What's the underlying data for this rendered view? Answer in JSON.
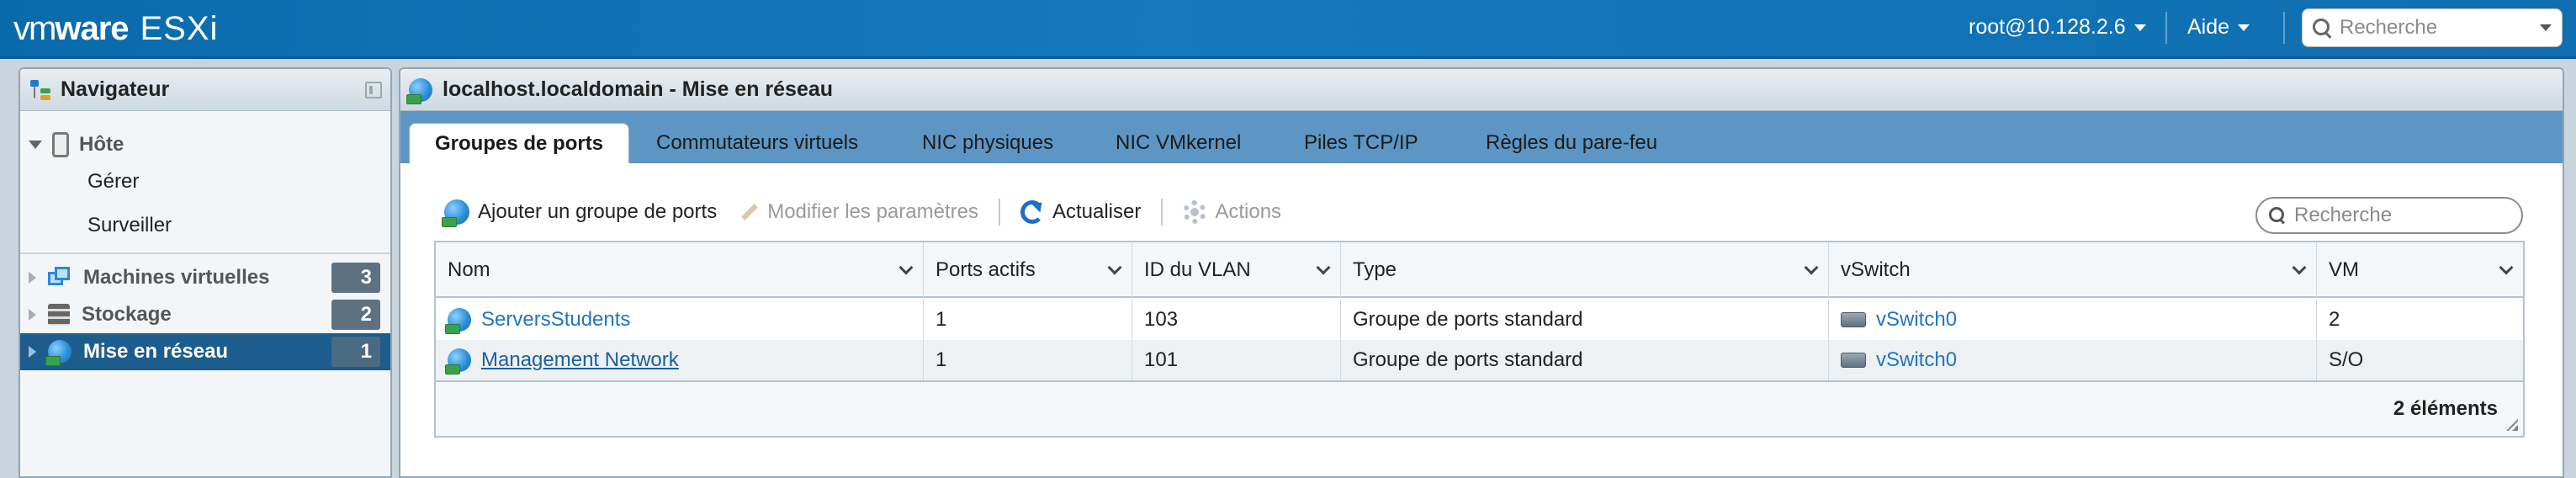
{
  "topbar": {
    "logo_vm": "vm",
    "logo_ware": "ware",
    "logo_product": "ESXi",
    "user": "root@10.128.2.6",
    "help": "Aide",
    "search_placeholder": "Recherche"
  },
  "navigator": {
    "title": "Navigateur",
    "host": {
      "label": "Hôte",
      "children": [
        "Gérer",
        "Surveiller"
      ]
    },
    "items": [
      {
        "label": "Machines virtuelles",
        "count": "3",
        "icon": "vm-icon"
      },
      {
        "label": "Stockage",
        "count": "2",
        "icon": "storage-icon"
      },
      {
        "label": "Mise en réseau",
        "count": "1",
        "icon": "network-icon",
        "selected": true
      }
    ]
  },
  "main": {
    "title": "localhost.localdomain - Mise en réseau",
    "tabs": [
      {
        "label": "Groupes de ports",
        "active": true
      },
      {
        "label": "Commutateurs virtuels"
      },
      {
        "label": "NIC physiques"
      },
      {
        "label": "NIC VMkernel"
      },
      {
        "label": "Piles TCP/IP"
      },
      {
        "label": "Règles du pare-feu"
      }
    ],
    "toolbar": {
      "add": "Ajouter un groupe de ports",
      "edit": "Modifier les paramètres",
      "refresh": "Actualiser",
      "actions": "Actions"
    },
    "search_placeholder": "Recherche",
    "table": {
      "columns": [
        "Nom",
        "Ports actifs",
        "ID du VLAN",
        "Type",
        "vSwitch",
        "VM"
      ],
      "rows": [
        {
          "name": "ServersStudents",
          "ports": "1",
          "vlan": "103",
          "type": "Groupe de ports standard",
          "vswitch": "vSwitch0",
          "vm": "2"
        },
        {
          "name": "Management Network",
          "ports": "1",
          "vlan": "101",
          "type": "Groupe de ports standard",
          "vswitch": "vSwitch0",
          "vm": "S/O"
        }
      ],
      "footer": "2 éléments"
    }
  },
  "colors": {
    "topbar": "#1479bd",
    "tabbar": "#5d96c4",
    "selected": "#1d5d8e",
    "link": "#1f76c0"
  }
}
